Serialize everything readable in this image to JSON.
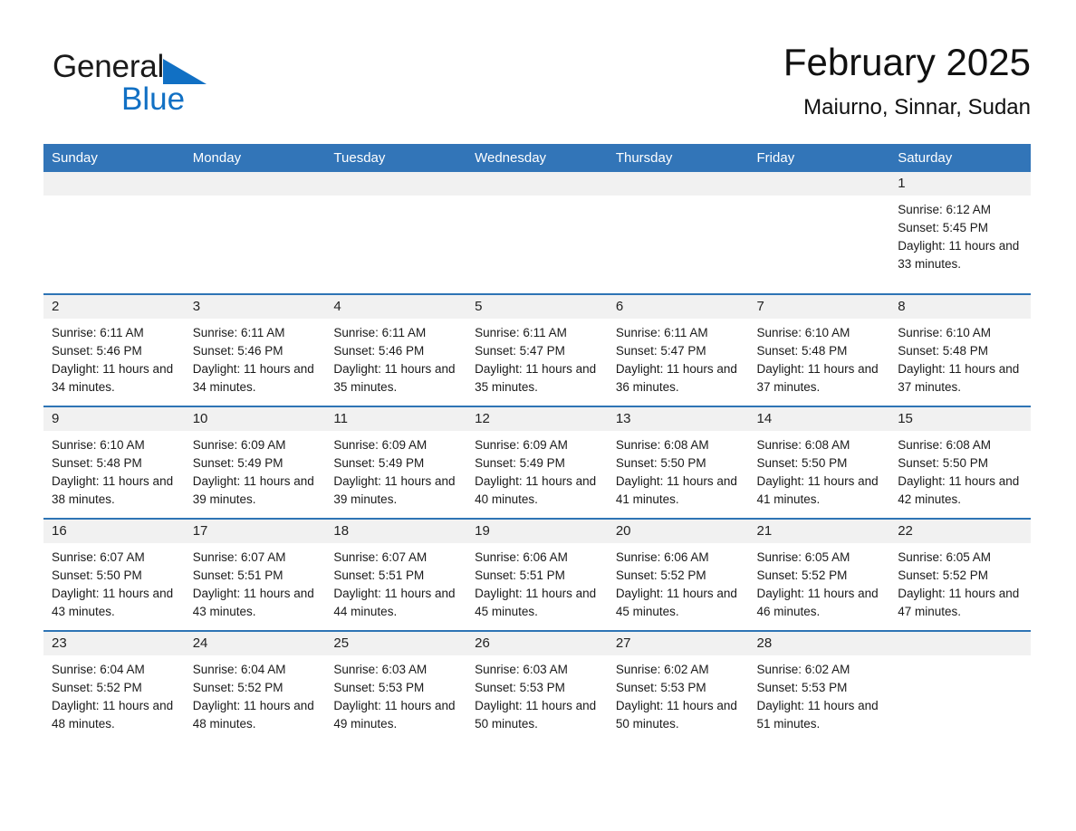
{
  "brand": {
    "word1": "General",
    "word2": "Blue",
    "triangle_color": "#1170c4"
  },
  "header": {
    "month_title": "February 2025",
    "location": "Maiurno, Sinnar, Sudan"
  },
  "colors": {
    "header_blue": "#3275b8",
    "row_divider_blue": "#2e74b5",
    "daynum_band": "#f1f1f1",
    "brand_blue": "#1170c4"
  },
  "calendar": {
    "weekday_headers": [
      "Sunday",
      "Monday",
      "Tuesday",
      "Wednesday",
      "Thursday",
      "Friday",
      "Saturday"
    ],
    "weeks": [
      [
        {
          "day": "",
          "sunrise": "",
          "sunset": "",
          "daylight": ""
        },
        {
          "day": "",
          "sunrise": "",
          "sunset": "",
          "daylight": ""
        },
        {
          "day": "",
          "sunrise": "",
          "sunset": "",
          "daylight": ""
        },
        {
          "day": "",
          "sunrise": "",
          "sunset": "",
          "daylight": ""
        },
        {
          "day": "",
          "sunrise": "",
          "sunset": "",
          "daylight": ""
        },
        {
          "day": "",
          "sunrise": "",
          "sunset": "",
          "daylight": ""
        },
        {
          "day": "1",
          "sunrise": "Sunrise: 6:12 AM",
          "sunset": "Sunset: 5:45 PM",
          "daylight": "Daylight: 11 hours and 33 minutes."
        }
      ],
      [
        {
          "day": "2",
          "sunrise": "Sunrise: 6:11 AM",
          "sunset": "Sunset: 5:46 PM",
          "daylight": "Daylight: 11 hours and 34 minutes."
        },
        {
          "day": "3",
          "sunrise": "Sunrise: 6:11 AM",
          "sunset": "Sunset: 5:46 PM",
          "daylight": "Daylight: 11 hours and 34 minutes."
        },
        {
          "day": "4",
          "sunrise": "Sunrise: 6:11 AM",
          "sunset": "Sunset: 5:46 PM",
          "daylight": "Daylight: 11 hours and 35 minutes."
        },
        {
          "day": "5",
          "sunrise": "Sunrise: 6:11 AM",
          "sunset": "Sunset: 5:47 PM",
          "daylight": "Daylight: 11 hours and 35 minutes."
        },
        {
          "day": "6",
          "sunrise": "Sunrise: 6:11 AM",
          "sunset": "Sunset: 5:47 PM",
          "daylight": "Daylight: 11 hours and 36 minutes."
        },
        {
          "day": "7",
          "sunrise": "Sunrise: 6:10 AM",
          "sunset": "Sunset: 5:48 PM",
          "daylight": "Daylight: 11 hours and 37 minutes."
        },
        {
          "day": "8",
          "sunrise": "Sunrise: 6:10 AM",
          "sunset": "Sunset: 5:48 PM",
          "daylight": "Daylight: 11 hours and 37 minutes."
        }
      ],
      [
        {
          "day": "9",
          "sunrise": "Sunrise: 6:10 AM",
          "sunset": "Sunset: 5:48 PM",
          "daylight": "Daylight: 11 hours and 38 minutes."
        },
        {
          "day": "10",
          "sunrise": "Sunrise: 6:09 AM",
          "sunset": "Sunset: 5:49 PM",
          "daylight": "Daylight: 11 hours and 39 minutes."
        },
        {
          "day": "11",
          "sunrise": "Sunrise: 6:09 AM",
          "sunset": "Sunset: 5:49 PM",
          "daylight": "Daylight: 11 hours and 39 minutes."
        },
        {
          "day": "12",
          "sunrise": "Sunrise: 6:09 AM",
          "sunset": "Sunset: 5:49 PM",
          "daylight": "Daylight: 11 hours and 40 minutes."
        },
        {
          "day": "13",
          "sunrise": "Sunrise: 6:08 AM",
          "sunset": "Sunset: 5:50 PM",
          "daylight": "Daylight: 11 hours and 41 minutes."
        },
        {
          "day": "14",
          "sunrise": "Sunrise: 6:08 AM",
          "sunset": "Sunset: 5:50 PM",
          "daylight": "Daylight: 11 hours and 41 minutes."
        },
        {
          "day": "15",
          "sunrise": "Sunrise: 6:08 AM",
          "sunset": "Sunset: 5:50 PM",
          "daylight": "Daylight: 11 hours and 42 minutes."
        }
      ],
      [
        {
          "day": "16",
          "sunrise": "Sunrise: 6:07 AM",
          "sunset": "Sunset: 5:50 PM",
          "daylight": "Daylight: 11 hours and 43 minutes."
        },
        {
          "day": "17",
          "sunrise": "Sunrise: 6:07 AM",
          "sunset": "Sunset: 5:51 PM",
          "daylight": "Daylight: 11 hours and 43 minutes."
        },
        {
          "day": "18",
          "sunrise": "Sunrise: 6:07 AM",
          "sunset": "Sunset: 5:51 PM",
          "daylight": "Daylight: 11 hours and 44 minutes."
        },
        {
          "day": "19",
          "sunrise": "Sunrise: 6:06 AM",
          "sunset": "Sunset: 5:51 PM",
          "daylight": "Daylight: 11 hours and 45 minutes."
        },
        {
          "day": "20",
          "sunrise": "Sunrise: 6:06 AM",
          "sunset": "Sunset: 5:52 PM",
          "daylight": "Daylight: 11 hours and 45 minutes."
        },
        {
          "day": "21",
          "sunrise": "Sunrise: 6:05 AM",
          "sunset": "Sunset: 5:52 PM",
          "daylight": "Daylight: 11 hours and 46 minutes."
        },
        {
          "day": "22",
          "sunrise": "Sunrise: 6:05 AM",
          "sunset": "Sunset: 5:52 PM",
          "daylight": "Daylight: 11 hours and 47 minutes."
        }
      ],
      [
        {
          "day": "23",
          "sunrise": "Sunrise: 6:04 AM",
          "sunset": "Sunset: 5:52 PM",
          "daylight": "Daylight: 11 hours and 48 minutes."
        },
        {
          "day": "24",
          "sunrise": "Sunrise: 6:04 AM",
          "sunset": "Sunset: 5:52 PM",
          "daylight": "Daylight: 11 hours and 48 minutes."
        },
        {
          "day": "25",
          "sunrise": "Sunrise: 6:03 AM",
          "sunset": "Sunset: 5:53 PM",
          "daylight": "Daylight: 11 hours and 49 minutes."
        },
        {
          "day": "26",
          "sunrise": "Sunrise: 6:03 AM",
          "sunset": "Sunset: 5:53 PM",
          "daylight": "Daylight: 11 hours and 50 minutes."
        },
        {
          "day": "27",
          "sunrise": "Sunrise: 6:02 AM",
          "sunset": "Sunset: 5:53 PM",
          "daylight": "Daylight: 11 hours and 50 minutes."
        },
        {
          "day": "28",
          "sunrise": "Sunrise: 6:02 AM",
          "sunset": "Sunset: 5:53 PM",
          "daylight": "Daylight: 11 hours and 51 minutes."
        },
        {
          "day": "",
          "sunrise": "",
          "sunset": "",
          "daylight": ""
        }
      ]
    ]
  }
}
